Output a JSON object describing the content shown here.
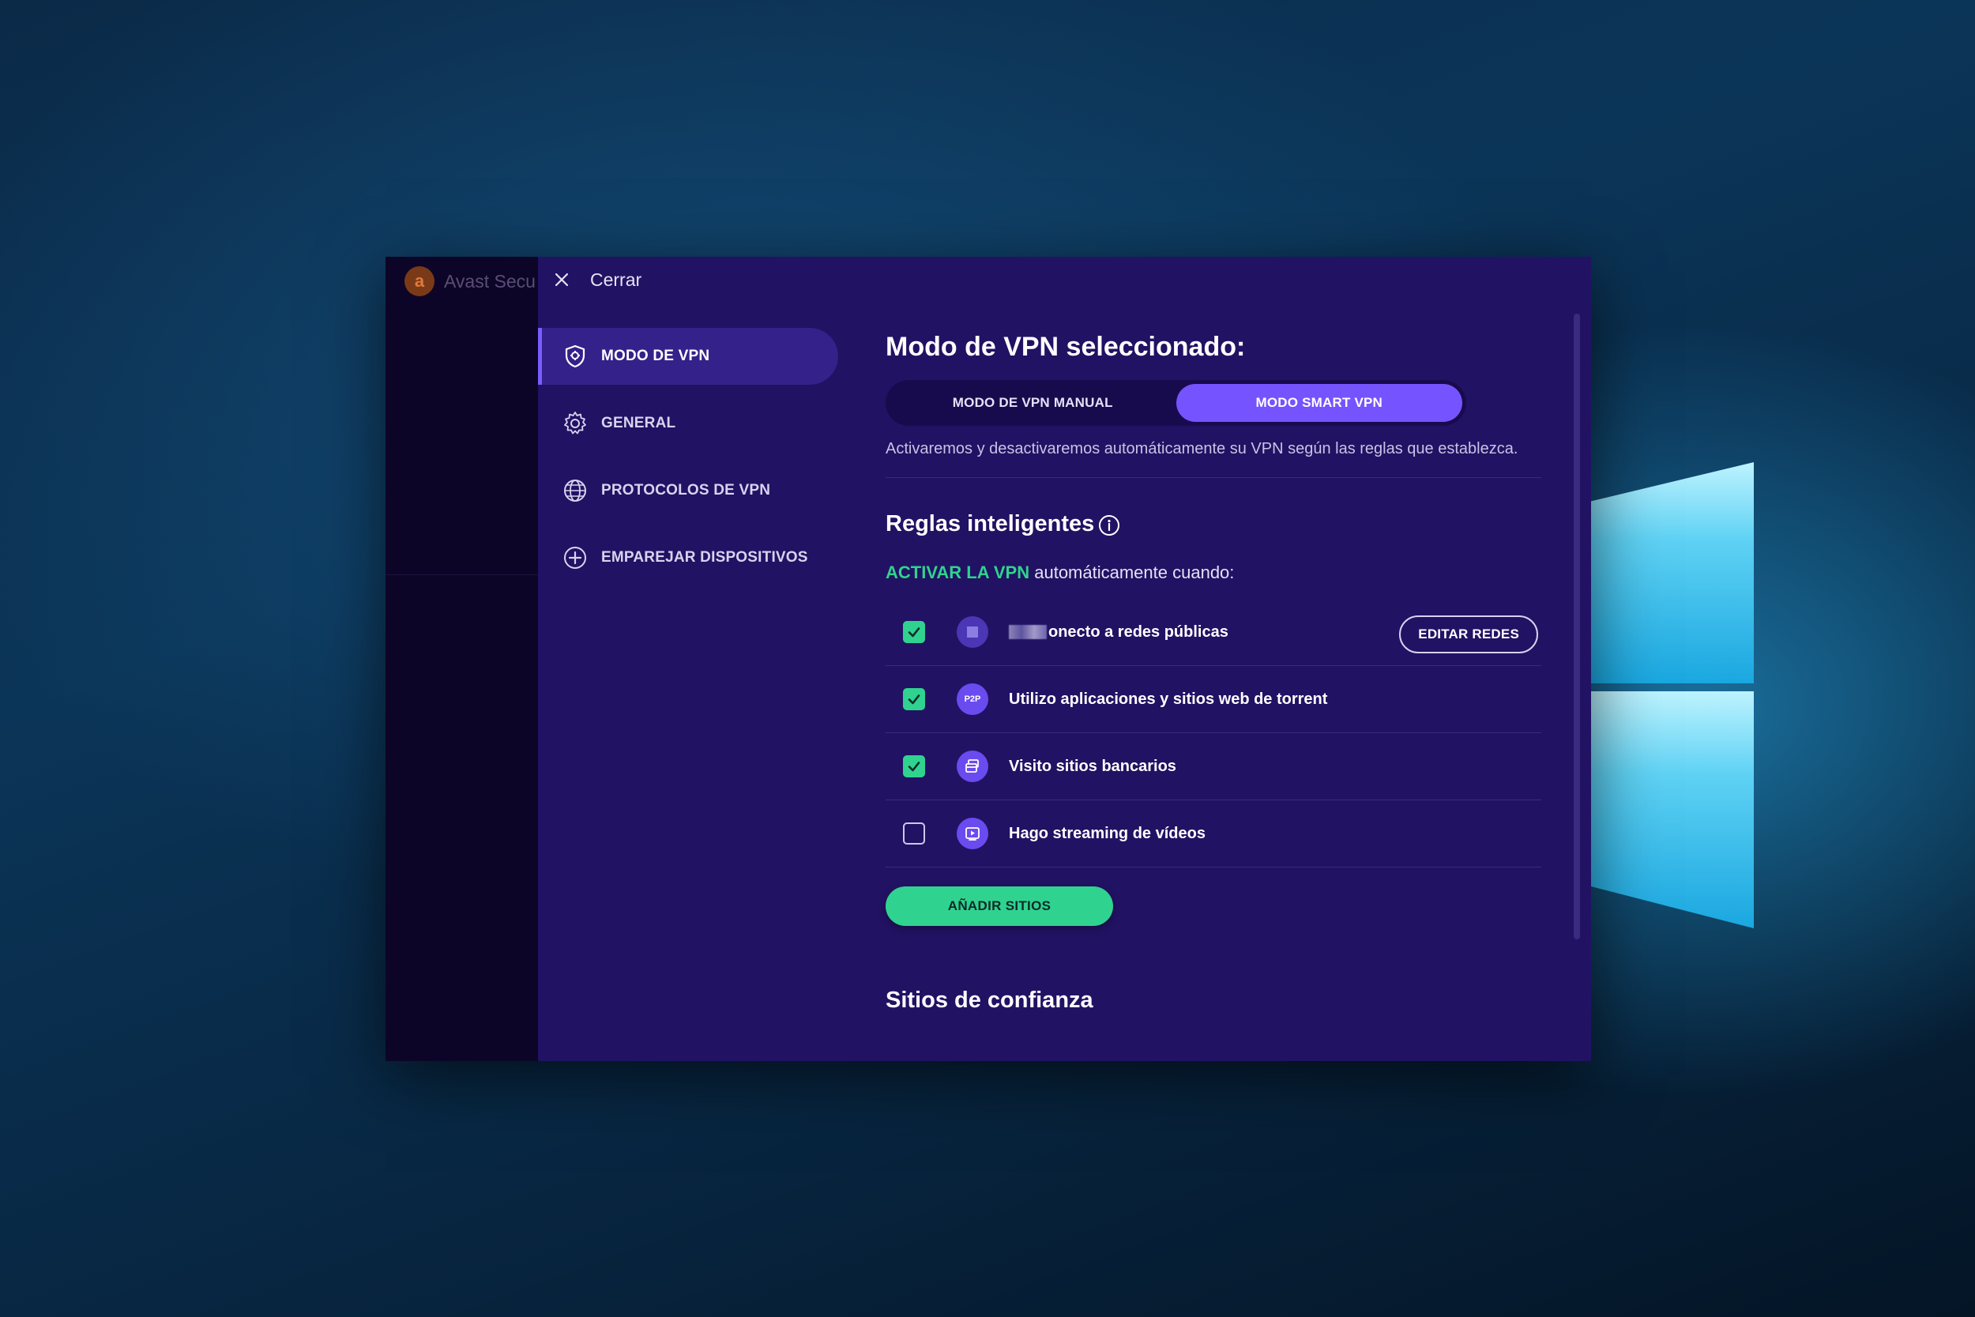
{
  "app": {
    "title": "Avast Secu"
  },
  "topbar": {
    "close_label": "Cerrar"
  },
  "nav": {
    "items": [
      {
        "label": "MODO DE VPN",
        "icon": "shield-icon",
        "active": true
      },
      {
        "label": "GENERAL",
        "icon": "gear-icon",
        "active": false
      },
      {
        "label": "PROTOCOLOS DE VPN",
        "icon": "globe-icon",
        "active": false
      },
      {
        "label": "EMPAREJAR DISPOSITIVOS",
        "icon": "plus-circle-icon",
        "active": false
      }
    ]
  },
  "main": {
    "title": "Modo de VPN seleccionado:",
    "toggle": {
      "manual_label": "MODO DE VPN MANUAL",
      "smart_label": "MODO SMART VPN",
      "selected": "smart"
    },
    "description": "Activaremos y desactivaremos automáticamente su VPN según las reglas que establezca.",
    "smart_rules_title": "Reglas inteligentes",
    "trigger_highlight": "ACTIVAR LA VPN",
    "trigger_rest": " automáticamente cuando:",
    "rules": [
      {
        "label": "onecto a redes públicas",
        "checked": true,
        "icon": "public-network-icon",
        "button": "EDITAR REDES"
      },
      {
        "label": "Utilizo aplicaciones y sitios web de torrent",
        "checked": true,
        "icon": "p2p-icon",
        "icon_text": "P2P"
      },
      {
        "label": "Visito sitios bancarios",
        "checked": true,
        "icon": "bank-card-icon"
      },
      {
        "label": "Hago streaming de vídeos",
        "checked": false,
        "icon": "video-play-icon"
      }
    ],
    "add_sites_label": "AÑADIR SITIOS",
    "trusted_sites_title": "Sitios de confianza"
  },
  "colors": {
    "accent": "#7553ff",
    "green": "#2fd38f",
    "panel": "#221263",
    "sidebar_dark": "#0d0527"
  }
}
